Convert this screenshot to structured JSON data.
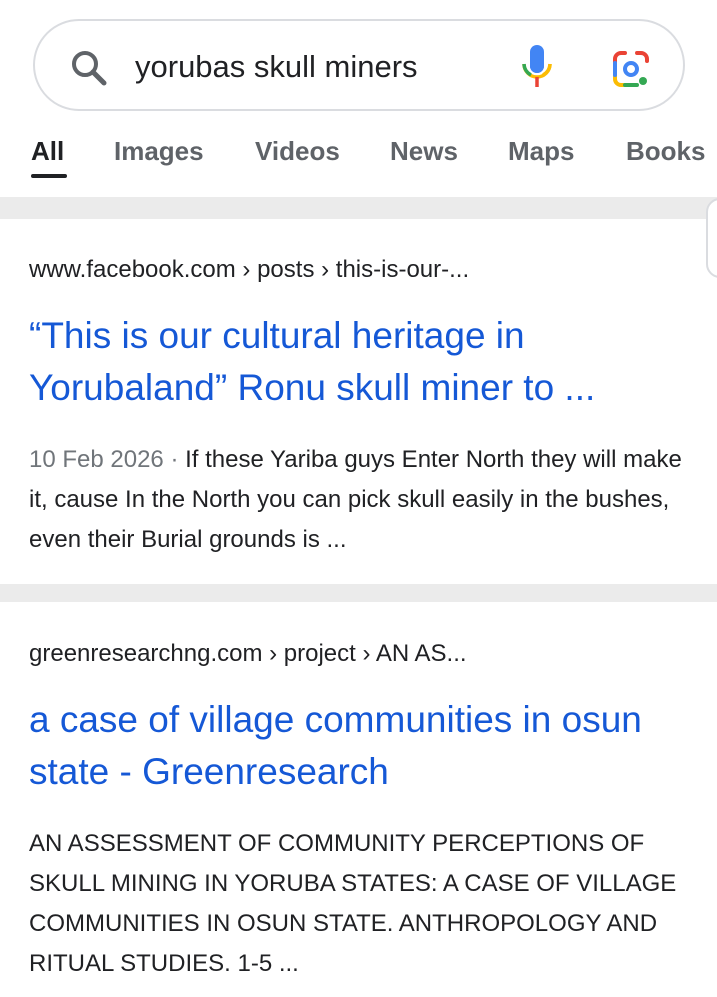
{
  "search": {
    "query": "yorubas skull miners"
  },
  "tabs": [
    {
      "label": "All",
      "active": true
    },
    {
      "label": "Images",
      "active": false
    },
    {
      "label": "Videos",
      "active": false
    },
    {
      "label": "News",
      "active": false
    },
    {
      "label": "Maps",
      "active": false
    },
    {
      "label": "Books",
      "active": false
    }
  ],
  "results": [
    {
      "url": "www.facebook.com › posts › this-is-our-...",
      "title": "“This is our cultural heritage in Yorubaland” Ronu skull miner to ...",
      "date": "10 Feb 2026 · ",
      "snippet": "If these Yariba guys Enter North they will make it, cause In the North you can pick skull easily in the bushes, even their Burial grounds is ..."
    },
    {
      "url": "greenresearchng.com › project › AN AS...",
      "title": "a case of village communities in osun state - Greenresearch",
      "snippet": "AN ASSESSMENT OF COMMUNITY PERCEPTIONS OF SKULL MINING IN YORUBA STATES: A CASE OF VILLAGE COMMUNITIES IN OSUN STATE. ANTHROPOLOGY AND RITUAL STUDIES. 1-5 ..."
    }
  ],
  "colors": {
    "link": "#1558d6",
    "text": "#202124",
    "muted": "#70757a",
    "tab_inactive": "#5f6368",
    "divider": "#ebebeb"
  }
}
